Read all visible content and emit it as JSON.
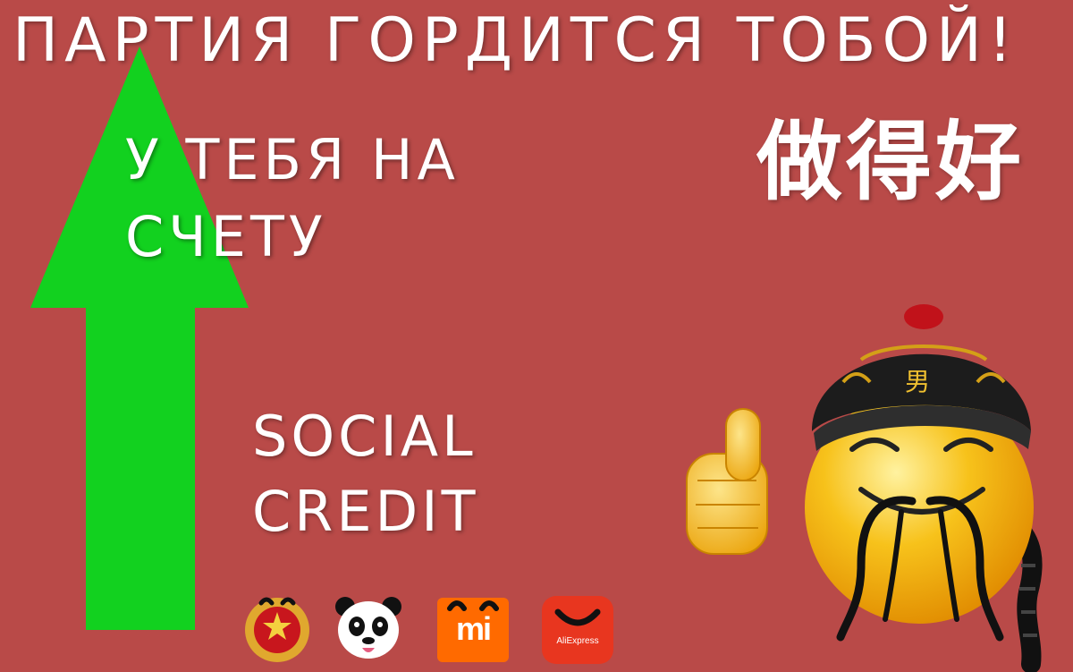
{
  "headline": "ПАРТИЯ ГОРДИТСЯ ТОБОЙ!",
  "counter_label": {
    "line1": "У ТЕБЯ НА",
    "line2": "СЧЕТУ"
  },
  "social_credit": {
    "line1": "SOCIAL",
    "line2": "CREDIT"
  },
  "chinese_caption": "做得好",
  "emperor_hat_character": "男",
  "badges": [
    {
      "icon": "national-emblem-icon"
    },
    {
      "icon": "panda-icon"
    },
    {
      "icon": "xiaomi-logo-icon",
      "text": "mi"
    },
    {
      "icon": "aliexpress-logo-icon",
      "text": "AliExpress"
    }
  ],
  "colors": {
    "background": "#b94a48",
    "arrow": "#12d11f",
    "text": "#ffffff",
    "emoji_yellow": "#f7c21b"
  }
}
